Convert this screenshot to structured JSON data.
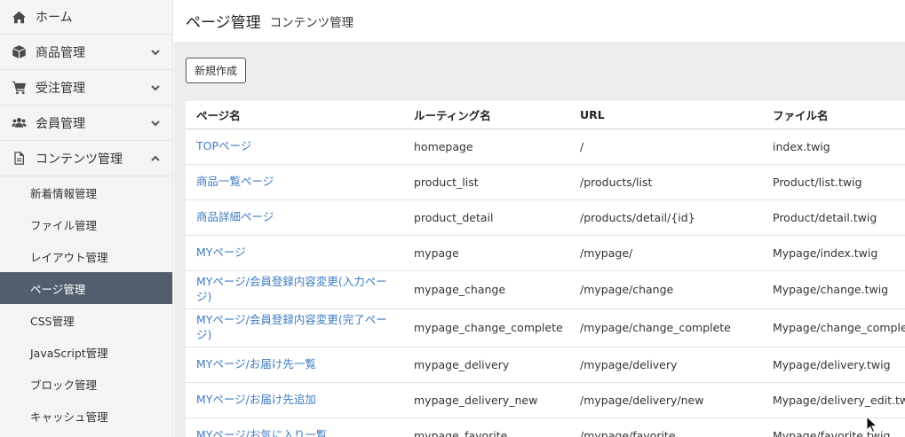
{
  "sidebar": {
    "main_items": [
      {
        "label": "ホーム"
      },
      {
        "label": "商品管理"
      },
      {
        "label": "受注管理"
      },
      {
        "label": "会員管理"
      },
      {
        "label": "コンテンツ管理"
      }
    ],
    "sub_items": [
      {
        "label": "新着情報管理"
      },
      {
        "label": "ファイル管理"
      },
      {
        "label": "レイアウト管理"
      },
      {
        "label": "ページ管理",
        "active": true
      },
      {
        "label": "CSS管理"
      },
      {
        "label": "JavaScript管理"
      },
      {
        "label": "ブロック管理"
      },
      {
        "label": "キャッシュ管理"
      }
    ]
  },
  "header": {
    "title": "ページ管理",
    "subtitle": "コンテンツ管理"
  },
  "toolbar": {
    "new_label": "新規作成"
  },
  "table": {
    "headers": [
      "ページ名",
      "ルーティング名",
      "URL",
      "ファイル名"
    ],
    "rows": [
      {
        "name": "TOPページ",
        "route": "homepage",
        "url": "/",
        "file": "index.twig"
      },
      {
        "name": "商品一覧ページ",
        "route": "product_list",
        "url": "/products/list",
        "file": "Product/list.twig"
      },
      {
        "name": "商品詳細ページ",
        "route": "product_detail",
        "url": "/products/detail/{id}",
        "file": "Product/detail.twig"
      },
      {
        "name": "MYページ",
        "route": "mypage",
        "url": "/mypage/",
        "file": "Mypage/index.twig"
      },
      {
        "name": "MYページ/会員登録内容変更(入力ページ)",
        "route": "mypage_change",
        "url": "/mypage/change",
        "file": "Mypage/change.twig"
      },
      {
        "name": "MYページ/会員登録内容変更(完了ページ)",
        "route": "mypage_change_complete",
        "url": "/mypage/change_complete",
        "file": "Mypage/change_complete.twig"
      },
      {
        "name": "MYページ/お届け先一覧",
        "route": "mypage_delivery",
        "url": "/mypage/delivery",
        "file": "Mypage/delivery.twig"
      },
      {
        "name": "MYページ/お届け先追加",
        "route": "mypage_delivery_new",
        "url": "/mypage/delivery/new",
        "file": "Mypage/delivery_edit.twig"
      },
      {
        "name": "MYページ/お気に入り一覧",
        "route": "mypage_favorite",
        "url": "/mypage/favorite",
        "file": "Mypage/favorite.twig"
      }
    ]
  },
  "colors": {
    "sidebar_active": "#525e6e",
    "link": "#3d7bc0",
    "content_bg": "#ecedef"
  }
}
